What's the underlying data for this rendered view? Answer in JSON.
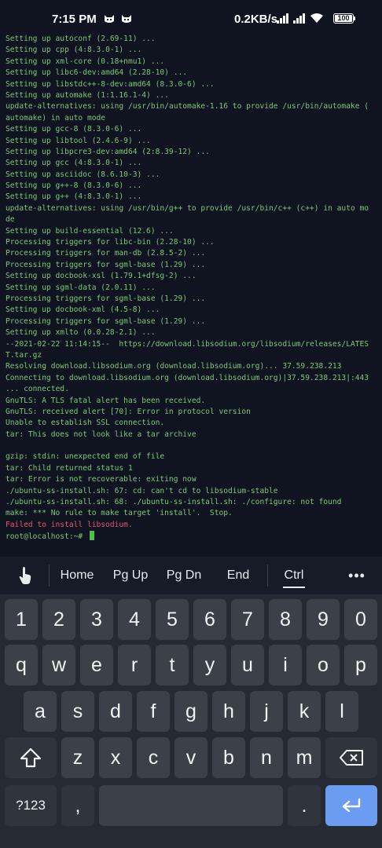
{
  "status_bar": {
    "time": "7:15 PM",
    "left_icons": [
      "cat-icon",
      "cat-icon"
    ],
    "net_speed": "0.2KB/s",
    "battery": "100"
  },
  "terminal": {
    "lines": [
      {
        "text": "Setting up autoconf (2.69-11) ...",
        "type": "normal"
      },
      {
        "text": "Setting up cpp (4:8.3.0-1) ...",
        "type": "normal"
      },
      {
        "text": "Setting up xml-core (0.18+nmu1) ...",
        "type": "normal"
      },
      {
        "text": "Setting up libc6-dev:amd64 (2.28-10) ...",
        "type": "normal"
      },
      {
        "text": "Setting up libstdc++-8-dev:amd64 (8.3.0-6) ...",
        "type": "normal"
      },
      {
        "text": "Setting up automake (1:1.16.1-4) ...",
        "type": "normal"
      },
      {
        "text": "update-alternatives: using /usr/bin/automake-1.16 to provide /usr/bin/automake (",
        "type": "normal"
      },
      {
        "text": "automake) in auto mode",
        "type": "normal"
      },
      {
        "text": "Setting up gcc-8 (8.3.0-6) ...",
        "type": "normal"
      },
      {
        "text": "Setting up libtool (2.4.6-9) ...",
        "type": "normal"
      },
      {
        "text": "Setting up libpcre3-dev:amd64 (2:8.39-12) ...",
        "type": "normal"
      },
      {
        "text": "Setting up gcc (4:8.3.0-1) ...",
        "type": "normal"
      },
      {
        "text": "Setting up asciidoc (8.6.10-3) ...",
        "type": "normal"
      },
      {
        "text": "Setting up g++-8 (8.3.0-6) ...",
        "type": "normal"
      },
      {
        "text": "Setting up g++ (4:8.3.0-1) ...",
        "type": "normal"
      },
      {
        "text": "update-alternatives: using /usr/bin/g++ to provide /usr/bin/c++ (c++) in auto mo",
        "type": "normal"
      },
      {
        "text": "de",
        "type": "normal"
      },
      {
        "text": "Setting up build-essential (12.6) ...",
        "type": "normal"
      },
      {
        "text": "Processing triggers for libc-bin (2.28-10) ...",
        "type": "normal"
      },
      {
        "text": "Processing triggers for man-db (2.8.5-2) ...",
        "type": "normal"
      },
      {
        "text": "Processing triggers for sgml-base (1.29) ...",
        "type": "normal"
      },
      {
        "text": "Setting up docbook-xsl (1.79.1+dfsg-2) ...",
        "type": "normal"
      },
      {
        "text": "Setting up sgml-data (2.0.11) ...",
        "type": "normal"
      },
      {
        "text": "Processing triggers for sgml-base (1.29) ...",
        "type": "normal"
      },
      {
        "text": "Setting up docbook-xml (4.5-8) ...",
        "type": "normal"
      },
      {
        "text": "Processing triggers for sgml-base (1.29) ...",
        "type": "normal"
      },
      {
        "text": "Setting up xmlto (0.0.28-2.1) ...",
        "type": "normal"
      },
      {
        "text": "--2021-02-22 11:14:15--  https://download.libsodium.org/libsodium/releases/LATES",
        "type": "normal"
      },
      {
        "text": "T.tar.gz",
        "type": "normal"
      },
      {
        "text": "Resolving download.libsodium.org (download.libsodium.org)... 37.59.238.213",
        "type": "normal"
      },
      {
        "text": "Connecting to download.libsodium.org (download.libsodium.org)|37.59.238.213|:443",
        "type": "normal"
      },
      {
        "text": "... connected.",
        "type": "normal"
      },
      {
        "text": "GnuTLS: A TLS fatal alert has been received.",
        "type": "normal"
      },
      {
        "text": "GnuTLS: received alert [70]: Error in protocol version",
        "type": "normal"
      },
      {
        "text": "Unable to establish SSL connection.",
        "type": "normal"
      },
      {
        "text": "tar: This does not look like a tar archive",
        "type": "normal"
      },
      {
        "text": "",
        "type": "normal"
      },
      {
        "text": "gzip: stdin: unexpected end of file",
        "type": "normal"
      },
      {
        "text": "tar: Child returned status 1",
        "type": "normal"
      },
      {
        "text": "tar: Error is not recoverable: exiting now",
        "type": "normal"
      },
      {
        "text": "./ubuntu-ss-install.sh: 67: cd: can't cd to libsodium-stable",
        "type": "normal"
      },
      {
        "text": "./ubuntu-ss-install.sh: 68: ./ubuntu-ss-install.sh: ./configure: not found",
        "type": "normal"
      },
      {
        "text": "make: *** No rule to make target 'install'.  Stop.",
        "type": "normal"
      },
      {
        "text": "Failed to install libsodium.",
        "type": "error"
      },
      {
        "text": "root@localhost:~# ",
        "type": "prompt"
      }
    ]
  },
  "extra_keys": {
    "touch_icon": "touch-hand-icon",
    "home": "Home",
    "pgup": "Pg Up",
    "pgdn": "Pg Dn",
    "end": "End",
    "ctrl": "Ctrl",
    "more_icon": "more-dots-icon",
    "more": "•••"
  },
  "keyboard": {
    "row1": [
      "1",
      "2",
      "3",
      "4",
      "5",
      "6",
      "7",
      "8",
      "9",
      "0"
    ],
    "row2": [
      "q",
      "w",
      "e",
      "r",
      "t",
      "y",
      "u",
      "i",
      "o",
      "p"
    ],
    "row3": [
      "a",
      "s",
      "d",
      "f",
      "g",
      "h",
      "j",
      "k",
      "l"
    ],
    "row4": [
      "z",
      "x",
      "c",
      "v",
      "b",
      "n",
      "m"
    ],
    "symbols_label": "?123",
    "comma": ",",
    "period": ".",
    "shift_icon": "shift-icon",
    "backspace_icon": "backspace-icon",
    "enter_icon": "enter-arrow-icon",
    "colors": {
      "key": "#3b4049",
      "func": "#2f343d",
      "enter": "#6a9df2",
      "bg": "#252a33"
    }
  }
}
